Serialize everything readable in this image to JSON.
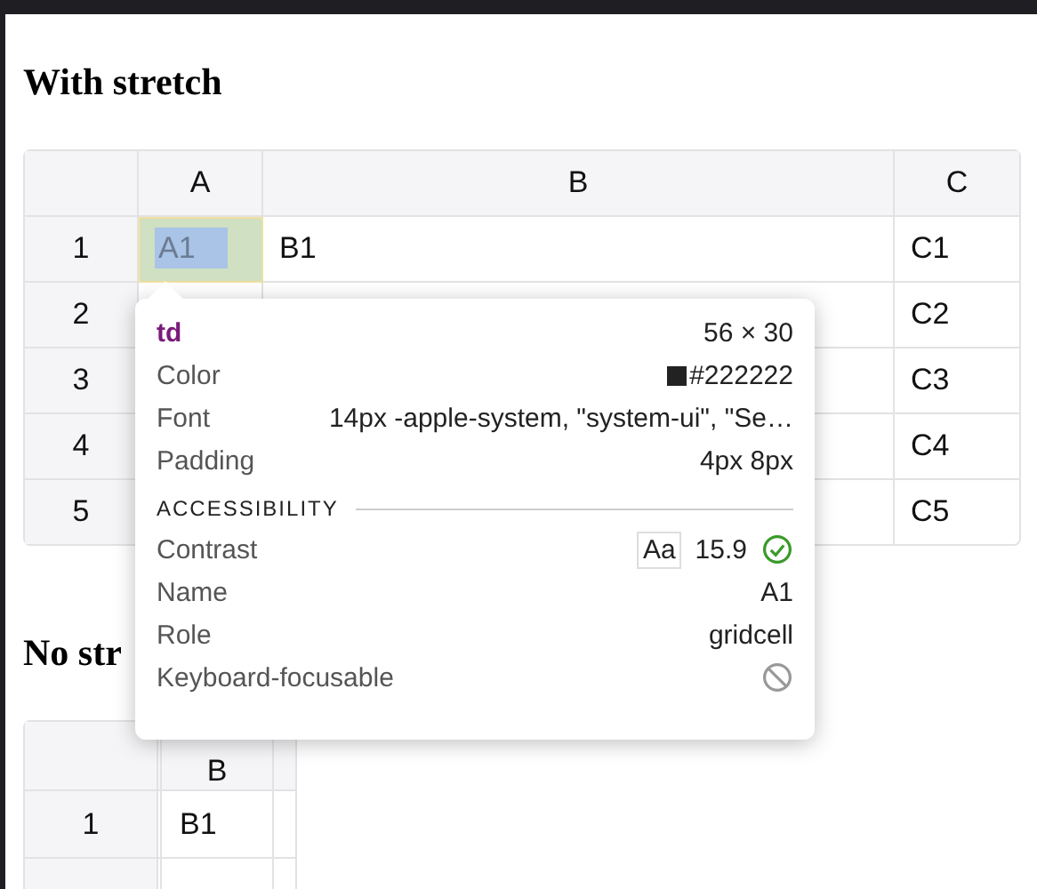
{
  "sections": [
    {
      "heading": "With stretch",
      "table": {
        "columns": [
          {
            "label": "A"
          },
          {
            "label": "B"
          },
          {
            "label": "C"
          }
        ],
        "rows": [
          {
            "number": "1",
            "cells": [
              {
                "text": "A1",
                "selected": true
              },
              {
                "text": "B1",
                "selected": false
              },
              {
                "text": "C1",
                "selected": false
              }
            ]
          },
          {
            "number": "2",
            "cells": [
              {},
              {},
              {
                "text": "C2",
                "selected": false
              }
            ]
          },
          {
            "number": "3",
            "cells": [
              {},
              {},
              {
                "text": "C3",
                "selected": false
              }
            ]
          },
          {
            "number": "4",
            "cells": [
              {},
              {},
              {
                "text": "C4",
                "selected": false
              }
            ]
          },
          {
            "number": "5",
            "cells": [
              {},
              {},
              {
                "text": "C5",
                "selected": false
              }
            ]
          }
        ]
      }
    },
    {
      "heading": "No str",
      "table": {
        "columns": [
          {},
          {
            "label": "B"
          },
          {}
        ],
        "rows": [
          {
            "number": "1",
            "cells": [
              {},
              {
                "text": "B1",
                "selected": false
              },
              {}
            ]
          },
          {
            "cells": [
              {},
              {},
              {}
            ]
          }
        ]
      }
    }
  ],
  "tooltip": {
    "tag": "td",
    "size": "56 × 30",
    "rows": [
      {
        "kind": "color",
        "label": "Color",
        "value": "#222222",
        "color": "#222222"
      },
      {
        "kind": "text",
        "label": "Font",
        "value": "14px -apple-system, \"system-ui\", \"Se…"
      },
      {
        "kind": "text",
        "label": "Padding",
        "value": "4px 8px"
      }
    ],
    "section": "ACCESSIBILITY",
    "accessibility": [
      {
        "kind": "contrast",
        "label": "Contrast",
        "sample": "Aa",
        "value": "15.9"
      },
      {
        "kind": "text",
        "label": "Name",
        "value": "A1"
      },
      {
        "kind": "text",
        "label": "Role",
        "value": "gridcell"
      },
      {
        "kind": "focusable",
        "label": "Keyboard-focusable"
      }
    ]
  }
}
